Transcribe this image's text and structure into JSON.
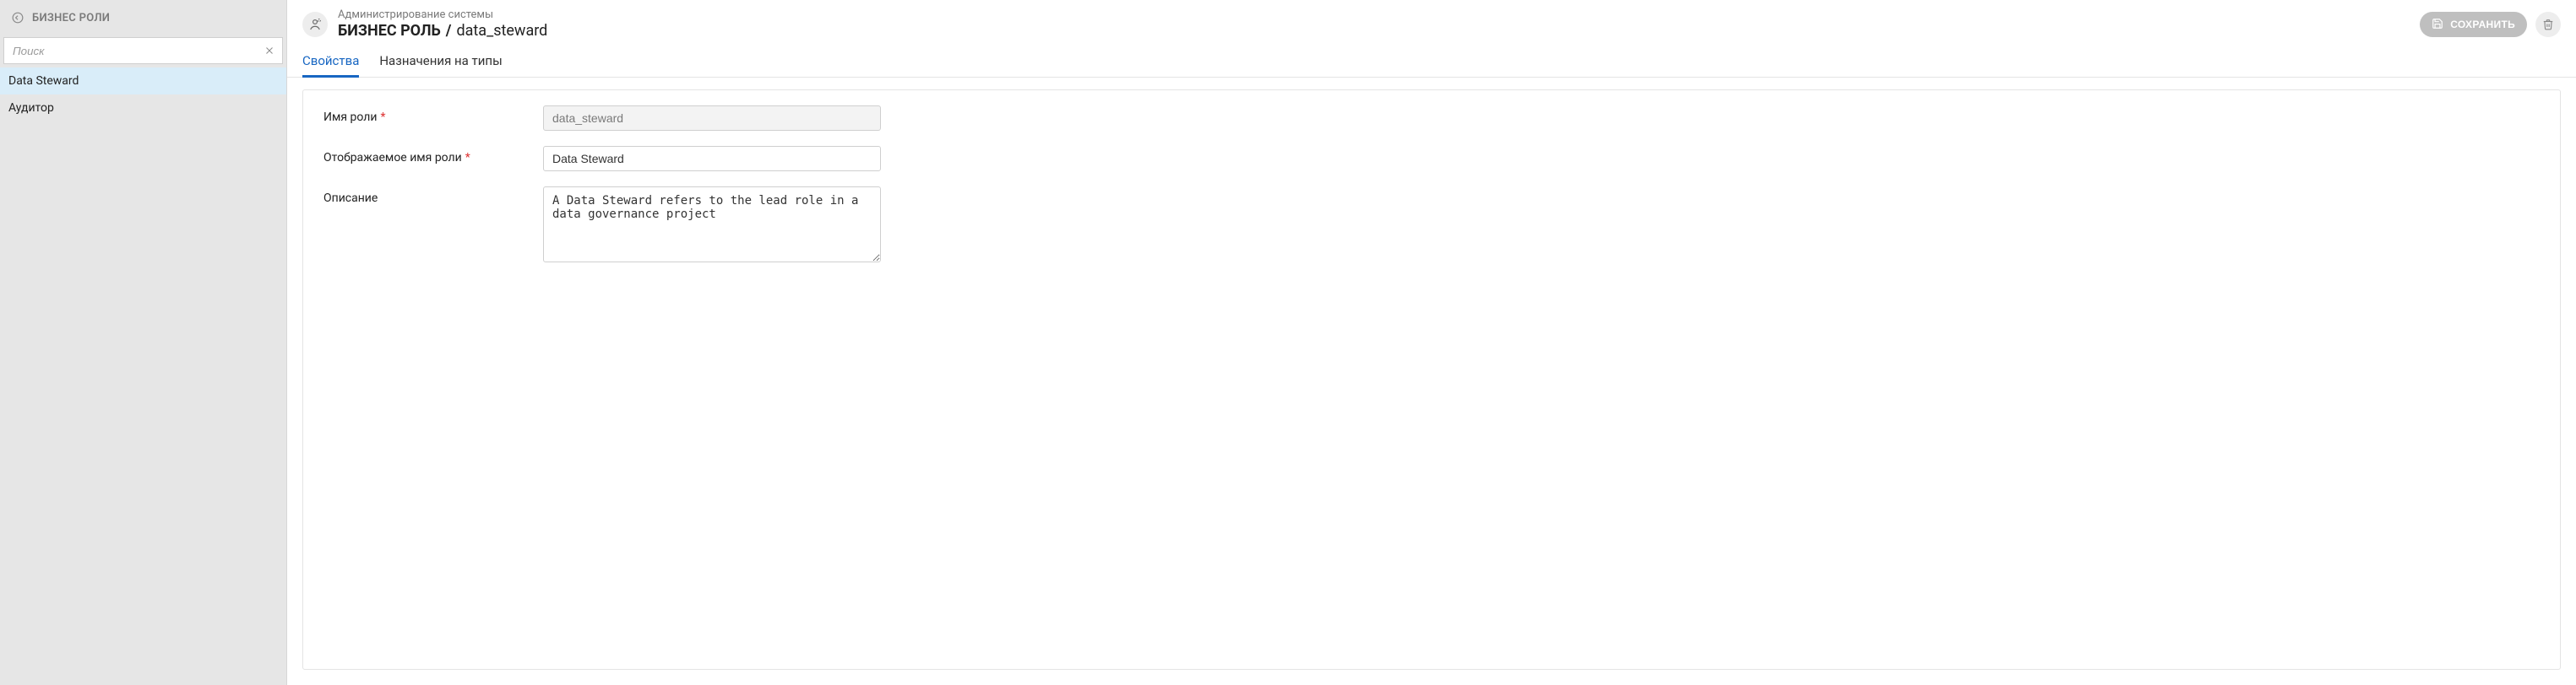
{
  "sidebar": {
    "title": "БИЗНЕС РОЛИ",
    "search_placeholder": "Поиск",
    "items": [
      {
        "label": "Data Steward",
        "selected": true
      },
      {
        "label": "Аудитор",
        "selected": false
      }
    ]
  },
  "header": {
    "breadcrumb": "Администрирование системы",
    "title_bold": "БИЗНЕС РОЛЬ",
    "title_sep": "/",
    "title_sub": "data_steward",
    "save_label": "СОХРАНИТЬ"
  },
  "tabs": [
    {
      "label": "Свойства",
      "active": true
    },
    {
      "label": "Назначения на типы",
      "active": false
    }
  ],
  "form": {
    "role_name_label": "Имя роли",
    "role_name_value": "data_steward",
    "display_name_label": "Отображаемое имя роли",
    "display_name_value": "Data Steward",
    "description_label": "Описание",
    "description_value": "A Data Steward refers to the lead role in a data governance project"
  }
}
